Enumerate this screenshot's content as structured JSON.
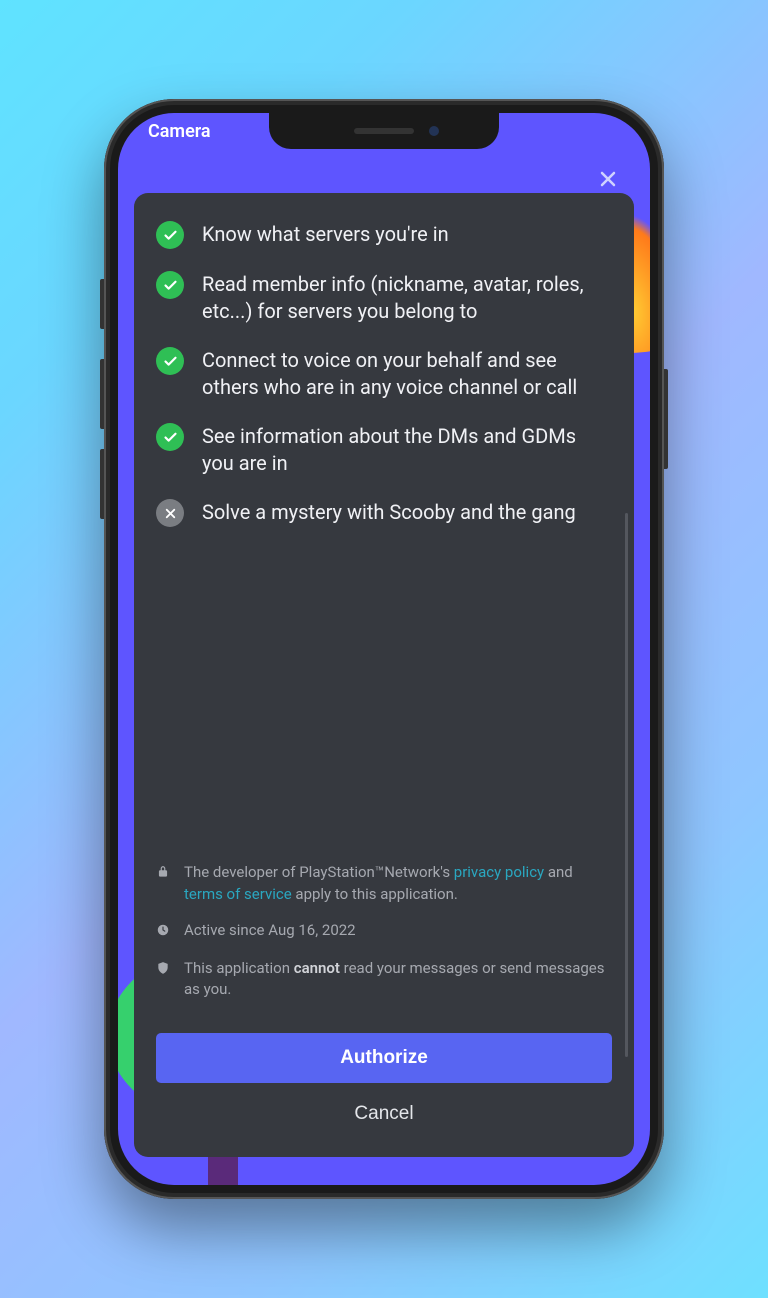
{
  "topbar": {
    "label": "Camera"
  },
  "permissions": [
    {
      "granted": true,
      "text": "Know what servers you're in"
    },
    {
      "granted": true,
      "text": "Read member info (nickname, avatar, roles, etc...) for servers you belong to"
    },
    {
      "granted": true,
      "text": "Connect to voice on your behalf and see others who are in any voice channel or call"
    },
    {
      "granted": true,
      "text": "See information about the DMs and GDMs you are in"
    },
    {
      "granted": false,
      "text": "Solve a mystery with Scooby and the gang"
    }
  ],
  "footer": {
    "dev_prefix": "The developer of PlayStation™Network's ",
    "privacy_link": "privacy policy",
    "and": " and ",
    "tos_link": "terms of service",
    "dev_suffix": " apply to this application.",
    "active_since": "Active since Aug 16, 2022",
    "cannot_prefix": "This application ",
    "cannot_strong": "cannot",
    "cannot_suffix": " read your messages or send messages as you."
  },
  "buttons": {
    "authorize": "Authorize",
    "cancel": "Cancel"
  }
}
